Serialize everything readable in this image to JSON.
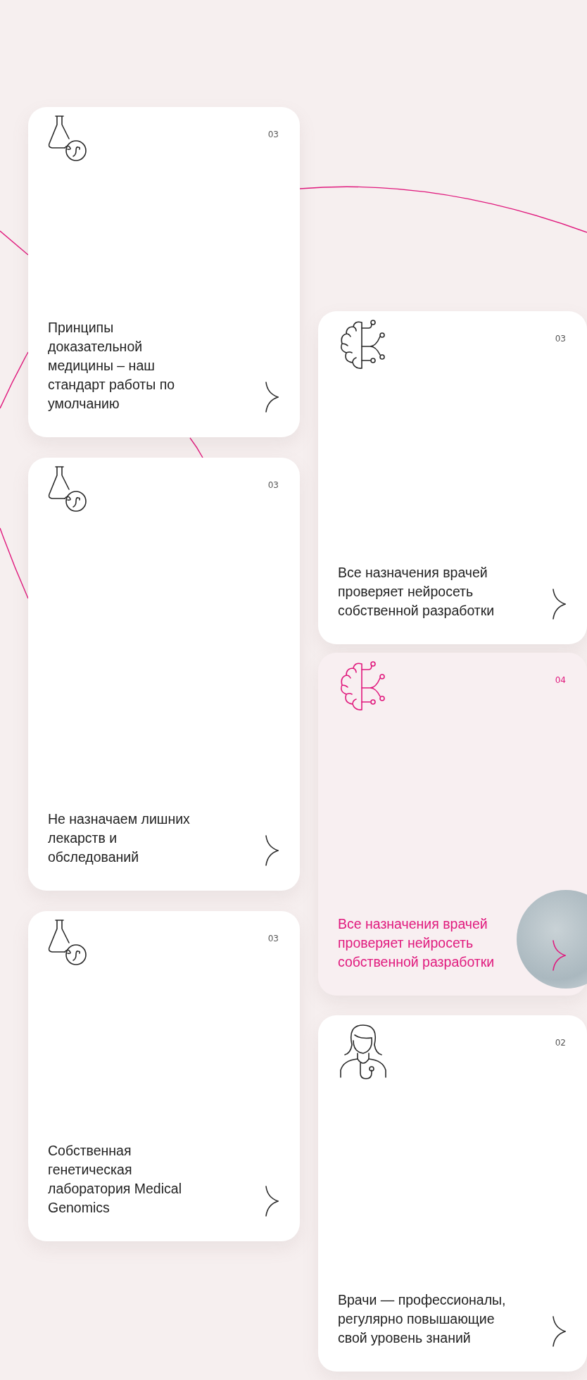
{
  "left_column": [
    {
      "number": "03",
      "kind": "flask",
      "text": "Принципы доказательной медицины – наш стандарт работы по умолчанию",
      "selected": false
    },
    {
      "number": "03",
      "kind": "flask",
      "text": "Не назначаем лишних лекарств и обследований",
      "selected": false
    },
    {
      "number": "03",
      "kind": "flask",
      "text": "Собственная генетическая лаборатория Medical Genomics",
      "selected": false
    }
  ],
  "right_column": [
    {
      "number": "03",
      "kind": "brain",
      "text": "Все назначения врачей проверяет нейросеть собственной разработки",
      "selected": false
    },
    {
      "number": "04",
      "kind": "brain",
      "text": "Все назначения врачей проверяет нейросеть собственной разработки",
      "selected": true
    },
    {
      "number": "02",
      "kind": "doctor",
      "text": "Врачи — профессионалы, регулярно повышающие свой уровень знаний",
      "selected": false
    }
  ]
}
